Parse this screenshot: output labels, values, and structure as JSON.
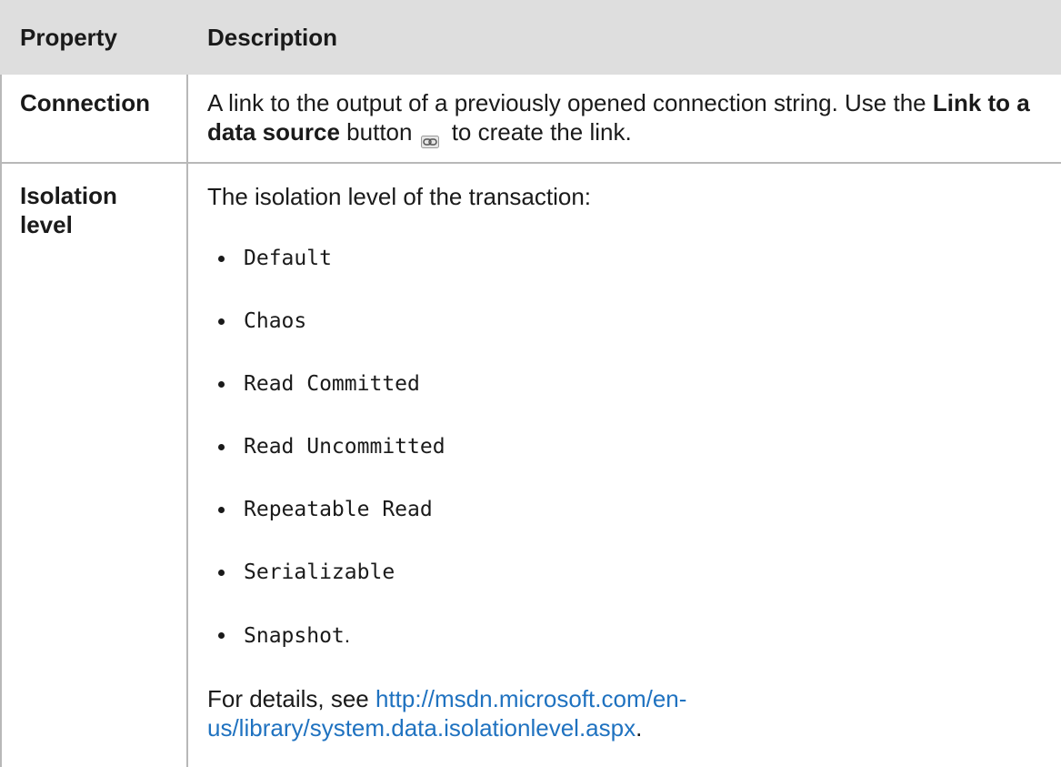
{
  "table": {
    "headers": {
      "property": "Property",
      "description": "Description"
    },
    "rows": [
      {
        "property": "Connection",
        "desc_part1": "A link to the output of a previously opened connection string. Use the ",
        "desc_bold": "Link to a data source",
        "desc_part2": " button",
        "icon": "link-chain-icon",
        "desc_part3": " to create the link."
      },
      {
        "property_line1": "Isolation",
        "property_line2": "level",
        "intro": "The isolation level of the transaction:",
        "options": [
          "Default",
          "Chaos",
          "Read Committed",
          "Read Uncommitted",
          "Repeatable Read",
          "Serializable",
          "Snapshot"
        ],
        "last_option_suffix": ".",
        "details_prefix": "For details, see ",
        "details_link_line1": "http://msdn.microsoft.com/en-",
        "details_link_line2": "us/library/system.data.isolationlevel.aspx",
        "details_suffix": "."
      }
    ]
  },
  "colors": {
    "header_bg": "#dedede",
    "border": "#b8b8b8",
    "link": "#1f72c0",
    "text": "#1a1a1a"
  }
}
